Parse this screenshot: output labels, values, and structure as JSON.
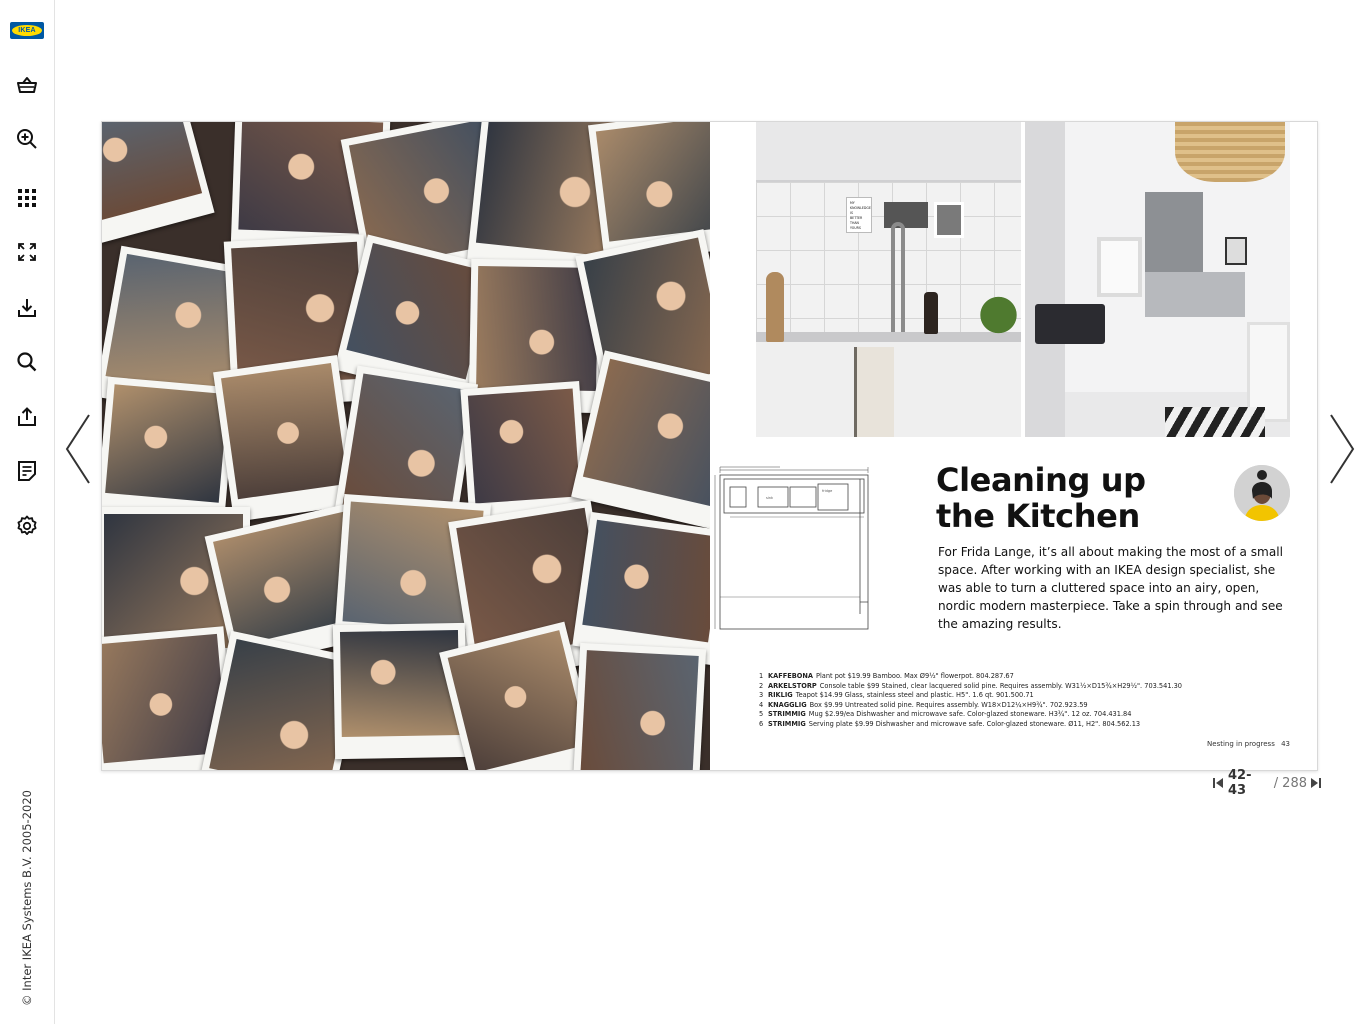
{
  "brand": {
    "logo_text": "IKEA"
  },
  "sidebar": {
    "items": [
      {
        "name": "basket",
        "icon": "basket-icon"
      },
      {
        "name": "zoom-in",
        "icon": "zoom-in-icon"
      },
      {
        "name": "grid",
        "icon": "grid-icon"
      },
      {
        "name": "fullscreen",
        "icon": "fullscreen-icon"
      },
      {
        "name": "download",
        "icon": "download-icon"
      },
      {
        "name": "search",
        "icon": "search-icon"
      },
      {
        "name": "share",
        "icon": "share-icon"
      },
      {
        "name": "notes",
        "icon": "notes-icon"
      },
      {
        "name": "settings",
        "icon": "gear-icon"
      }
    ],
    "copyright": "© Inter IKEA Systems B.V. 2005-2020"
  },
  "right_page": {
    "kitchen_note": [
      "MY",
      "KNOWLEDGE",
      "IS",
      "BETTER",
      "THAN",
      "YOURS"
    ],
    "title_line1": "Cleaning up",
    "title_line2": "the Kitchen",
    "body": "For Frida Lange, it’s all about making the most of a small space. After working with an IKEA design specialist, she was able to turn a cluttered space into an airy, open, nordic modern masterpiece. Take a spin through and see the amazing results.",
    "products": [
      {
        "num": "1",
        "name": "KAFFEBÖNA",
        "desc": "Plant pot $19.99 Bamboo. Max Ø9½\" flowerpot. 804.287.67"
      },
      {
        "num": "2",
        "name": "ARKELSTORP",
        "desc": "Console table $99 Stained, clear lacquered solid pine. Requires assembly. W31½×D15¾×H29½\". 703.541.30"
      },
      {
        "num": "3",
        "name": "RIKLIG",
        "desc": "Teapot $14.99 Glass, stainless steel and plastic. H5\". 1.6 qt. 901.500.71"
      },
      {
        "num": "4",
        "name": "KNAGGLIG",
        "desc": "Box $9.99 Untreated solid pine. Requires assembly. W18×D12¼×H9¾\". 702.923.59"
      },
      {
        "num": "5",
        "name": "STRIMMIG",
        "desc": "Mug $2.99/ea Dishwasher and microwave safe. Color-glazed stoneware. H3¾\". 12 oz. 704.431.84"
      },
      {
        "num": "6",
        "name": "STRIMMIG",
        "desc": "Serving plate $9.99 Dishwasher and microwave safe. Color-glazed stoneware. Ø11, H2\". 804.562.13"
      }
    ],
    "footer_section": "Nesting in progress",
    "footer_page": "43"
  },
  "pagination": {
    "current": "42-43",
    "separator": "/",
    "total": "288"
  },
  "colors": {
    "ikea_blue": "#0058a3",
    "ikea_yellow": "#ffdb00"
  }
}
